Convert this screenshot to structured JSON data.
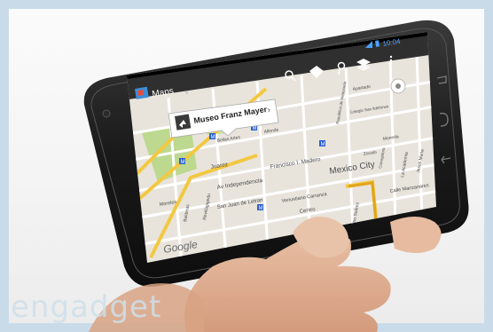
{
  "status_bar": {
    "time": "10:04"
  },
  "action_bar": {
    "app_title": "Maps",
    "icons": [
      "search-icon",
      "directions-icon",
      "places-icon",
      "layers-icon",
      "overflow-menu-icon"
    ]
  },
  "place_callout": {
    "name": "Museo Franz Mayer",
    "chevron": "›"
  },
  "map": {
    "labels": {
      "francisco_madero": "Francisco I. Madero",
      "mexico_city": "Mexico City",
      "av_independencia": "Av Independencia",
      "juarez": "Juarez",
      "san_juan_letran": "San Juan de Letran",
      "centro": "Centro",
      "venustiano_carranza": "Venustiano Carranza",
      "calle_manzanares": "Calle Manzanares",
      "bellas_artes": "Bellas Artes",
      "allende": "Allende",
      "colegio_san_ildefonso": "Colegio San Ildefonso",
      "apartado": "Apartado",
      "moneda": "Moneda",
      "morelos": "Morelos",
      "balderas": "Balderas",
      "revillagigedo": "Revillagigedo",
      "la_academia": "La Academia",
      "jesus_maria": "Jesus Maria",
      "corregidora": "Corregidora",
      "pino_suarez": "Pino Suárez",
      "republica_venezuela": "Republica de Venezuela",
      "zocalo": "Zocalo"
    },
    "google_logo": "Google",
    "metro_symbol": "M"
  },
  "watermark": "engadget"
}
